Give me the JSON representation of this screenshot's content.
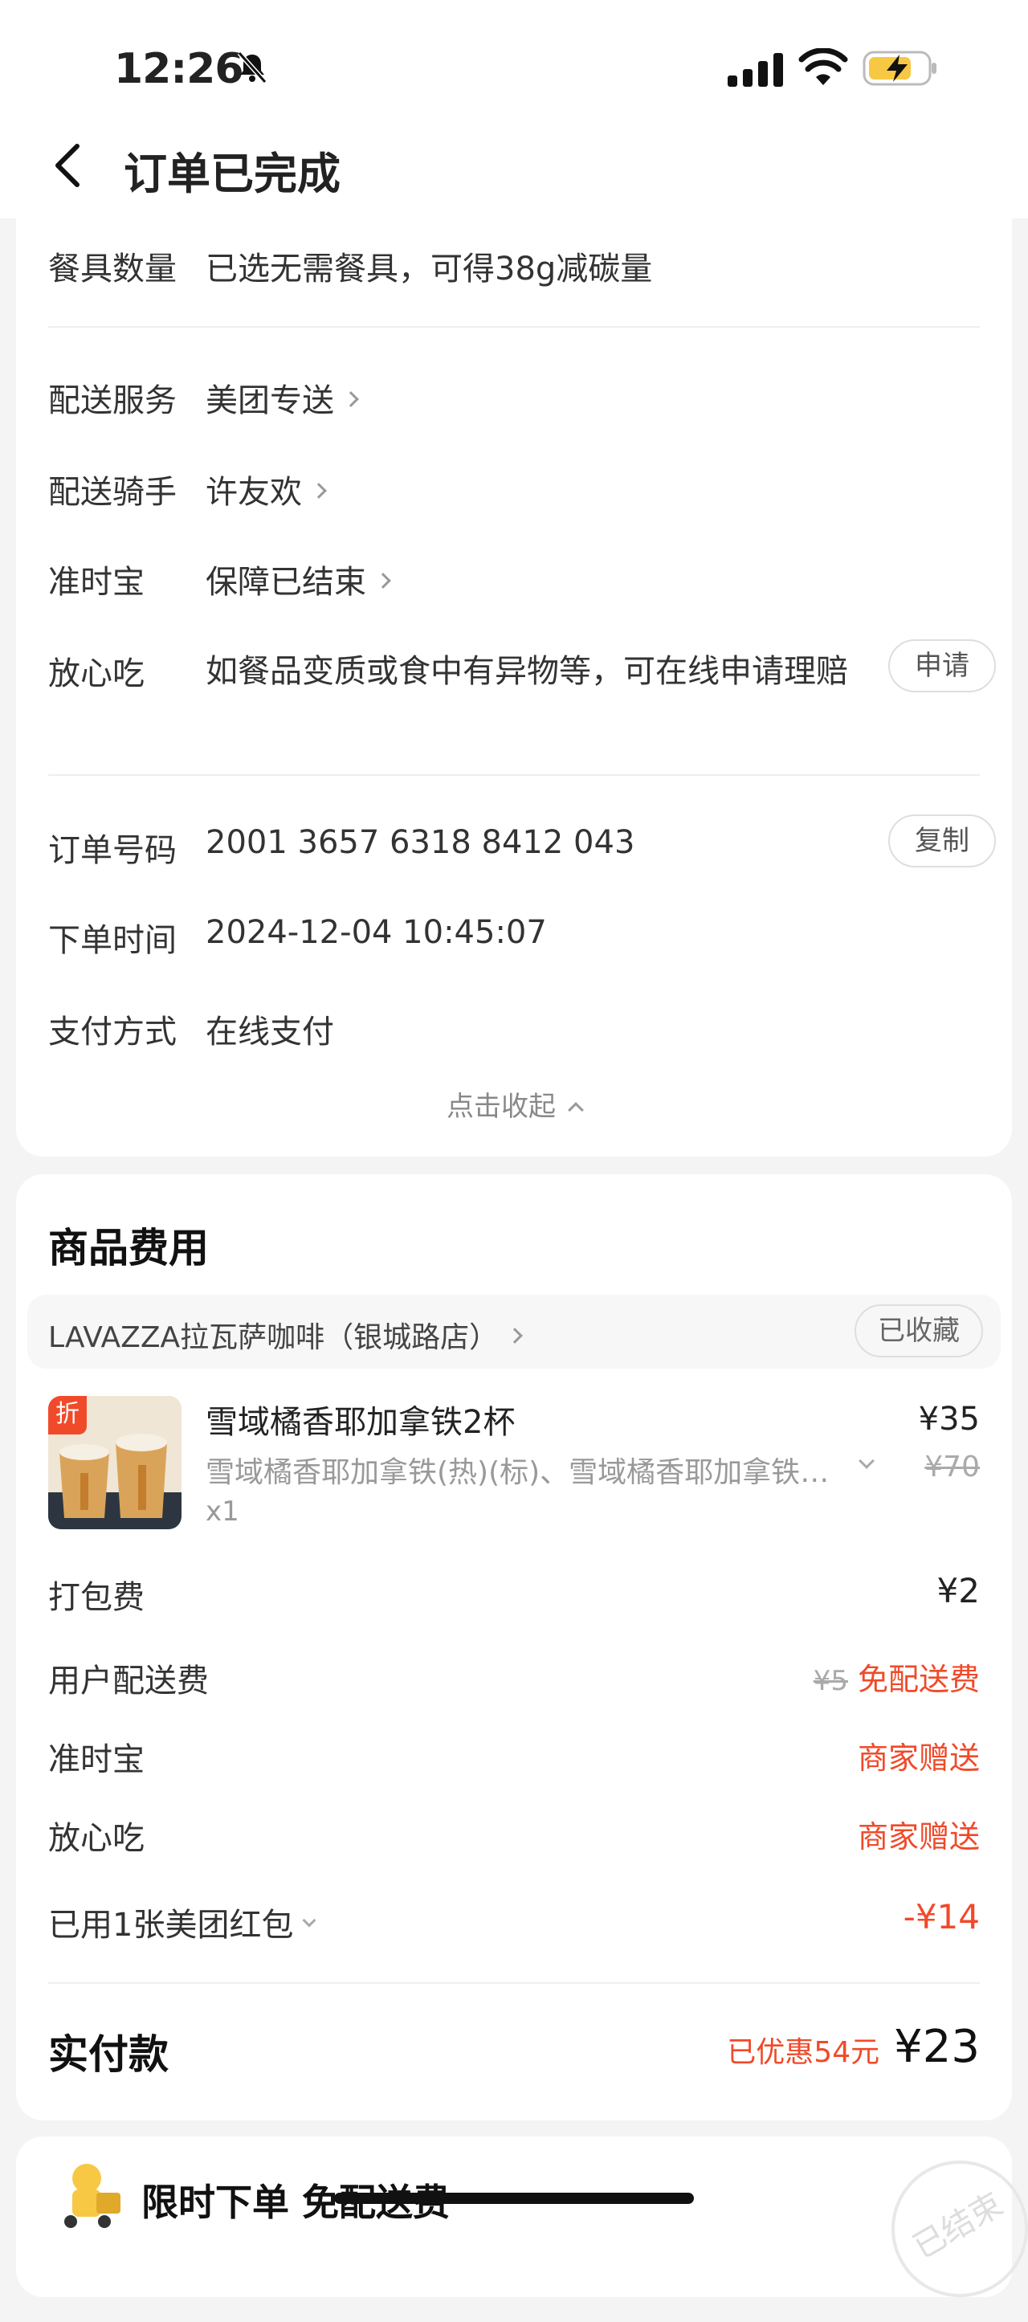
{
  "status_bar": {
    "time": "12:26"
  },
  "nav": {
    "title": "订单已完成"
  },
  "order_info": {
    "tableware_label": "餐具数量",
    "tableware_value": "已选无需餐具，可得38g减碳量",
    "delivery_service_label": "配送服务",
    "delivery_service_value": "美团专送",
    "rider_label": "配送骑手",
    "rider_value": "许友欢",
    "ontime_label": "准时宝",
    "ontime_value": "保障已结束",
    "safe_label": "放心吃",
    "safe_value": "如餐品变质或食中有异物等，可在线申请理赔",
    "apply_btn": "申请",
    "order_no_label": "订单号码",
    "order_no_value": "2001 3657 6318 8412 043",
    "copy_btn": "复制",
    "order_time_label": "下单时间",
    "order_time_value": "2024-12-04 10:45:07",
    "payment_label": "支付方式",
    "payment_value": "在线支付",
    "collapse_label": "点击收起"
  },
  "goods": {
    "section_title": "商品费用",
    "store_name": "LAVAZZA拉瓦萨咖啡（银城路店）",
    "favorite_btn": "已收藏",
    "product": {
      "tag": "折",
      "name": "雪域橘香耶加拿铁2杯",
      "desc": "雪域橘香耶加拿铁(热)(标)、雪域橘香耶加拿铁(…",
      "qty": "x1",
      "price": "¥35",
      "original_price": "¥70"
    },
    "packing_label": "打包费",
    "packing_value": "¥2",
    "delivery_fee_label": "用户配送费",
    "delivery_fee_original": "¥5",
    "delivery_fee_value": "免配送费",
    "ontime_label": "准时宝",
    "ontime_value": "商家赠送",
    "safe_label": "放心吃",
    "safe_value": "商家赠送",
    "redpacket_label": "已用1张美团红包",
    "redpacket_value": "-¥14",
    "paid_label": "实付款",
    "saved_text": "已优惠54元",
    "paid_value": "¥23"
  },
  "promo": {
    "title": "限时下单 免配送费",
    "stamp": "已结束"
  },
  "colors": {
    "accent_red": "#f04a2a",
    "battery_yellow": "#f7c844"
  }
}
